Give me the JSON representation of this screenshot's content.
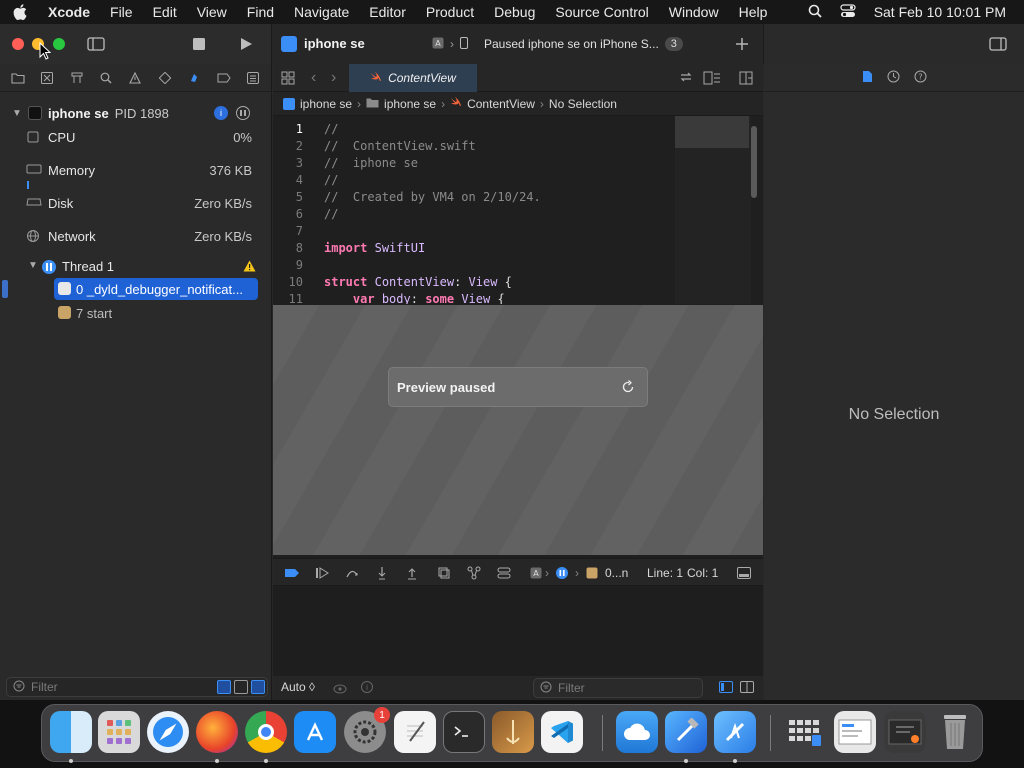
{
  "menubar": {
    "app_name": "Xcode",
    "items": [
      "File",
      "Edit",
      "View",
      "Find",
      "Navigate",
      "Editor",
      "Product",
      "Debug",
      "Source Control",
      "Window",
      "Help"
    ],
    "clock": "Sat Feb 10  10:01 PM"
  },
  "toolbar": {
    "scheme_name": "iphone se",
    "status_text": "Paused iphone se on iPhone S...",
    "status_count": "3"
  },
  "navigator": {
    "process_name": "iphone se",
    "process_pid": "PID 1898",
    "gauges": [
      {
        "label": "CPU",
        "value": "0%"
      },
      {
        "label": "Memory",
        "value": "376 KB"
      },
      {
        "label": "Disk",
        "value": "Zero KB/s"
      },
      {
        "label": "Network",
        "value": "Zero KB/s"
      }
    ],
    "thread_label": "Thread 1",
    "frames": [
      {
        "label": "0 _dyld_debugger_notificat...",
        "selected": true
      },
      {
        "label": "7 start",
        "selected": false
      }
    ],
    "filter_placeholder": "Filter"
  },
  "editor": {
    "tab_name": "ContentView",
    "breadcrumb": [
      "iphone se",
      "iphone se",
      "ContentView",
      "No Selection"
    ],
    "line_numbers": [
      "1",
      "2",
      "3",
      "4",
      "5",
      "6",
      "7",
      "8",
      "9",
      "10",
      "11"
    ],
    "code_lines": [
      "//",
      "//  ContentView.swift",
      "//  iphone se",
      "//",
      "//  Created by VM4 on 2/10/24.",
      "//",
      "",
      "import SwiftUI",
      "",
      "struct ContentView: View {",
      "    var body: some View {"
    ],
    "preview_text": "Preview paused",
    "debug_frame": "0...n",
    "line_label": "Line: 1",
    "col_label": "Col: 1",
    "console_mode": "Auto ◊",
    "console_filter_placeholder": "Filter"
  },
  "inspector": {
    "empty_text": "No Selection"
  },
  "dock": {
    "apps": [
      "finder-icon",
      "launchpad-icon",
      "safari-icon",
      "firefox-icon",
      "chrome-icon",
      "app-store-icon",
      "system-settings-icon",
      "textedit-icon",
      "terminal-icon",
      "instruments-icon",
      "vscode-icon",
      "icloud-icon",
      "xcode-icon",
      "simulator-icon",
      "grid-folder-icon",
      "screenshot-icon",
      "downloads-icon",
      "trash-icon"
    ],
    "settings_badge": "1"
  },
  "colors": {
    "accent": "#1f62d6",
    "keyword": "#ff7ab2",
    "type": "#dabaff",
    "comment": "#8b8b8b",
    "warning": "#f5c518"
  }
}
